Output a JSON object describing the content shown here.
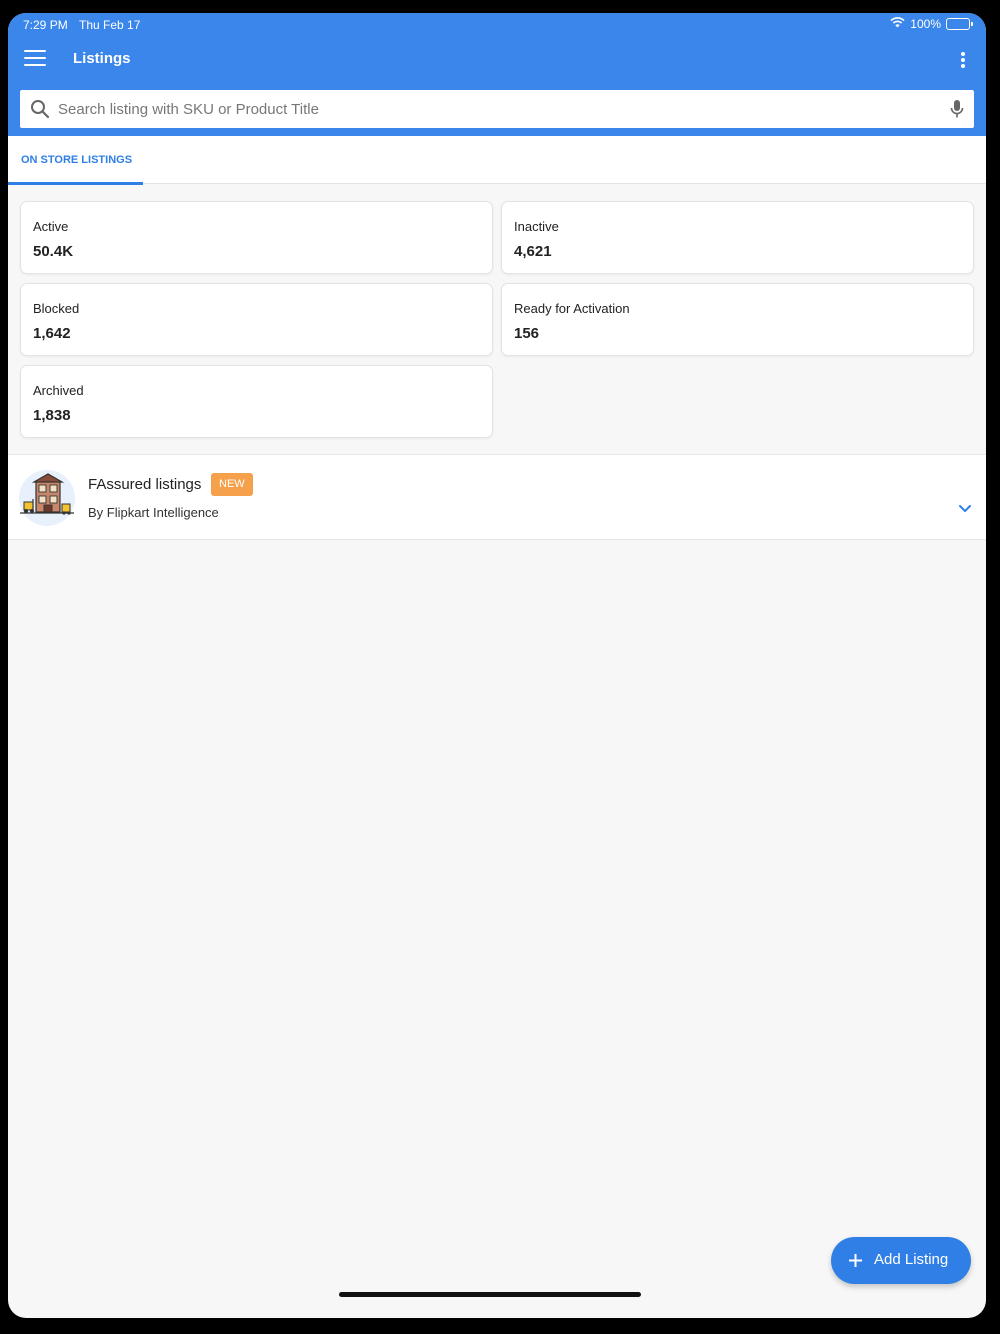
{
  "status_bar": {
    "time": "7:29 PM",
    "date": "Thu Feb 17",
    "battery": "100%"
  },
  "header": {
    "title": "Listings"
  },
  "search": {
    "placeholder": "Search listing with SKU or Product Title",
    "value": ""
  },
  "tabs": [
    {
      "label": "ON STORE LISTINGS",
      "active": true
    }
  ],
  "stats": [
    {
      "label": "Active",
      "value": "50.4K"
    },
    {
      "label": "Inactive",
      "value": "4,621"
    },
    {
      "label": "Blocked",
      "value": "1,642"
    },
    {
      "label": "Ready for Activation",
      "value": "156"
    },
    {
      "label": "Archived",
      "value": "1,838"
    }
  ],
  "fassured": {
    "title": "FAssured listings",
    "badge": "NEW",
    "subtitle": "By Flipkart Intelligence"
  },
  "fab": {
    "label": "Add Listing"
  },
  "colors": {
    "primary": "#3a86ea",
    "accent": "#2f7fe6",
    "badge": "#f5a04a",
    "background": "#f7f7f7"
  },
  "icons": {
    "menu": "hamburger-icon",
    "more": "more-vertical-icon",
    "search": "search-icon",
    "mic": "mic-icon",
    "chevron": "chevron-down-icon",
    "add": "plus-icon"
  }
}
